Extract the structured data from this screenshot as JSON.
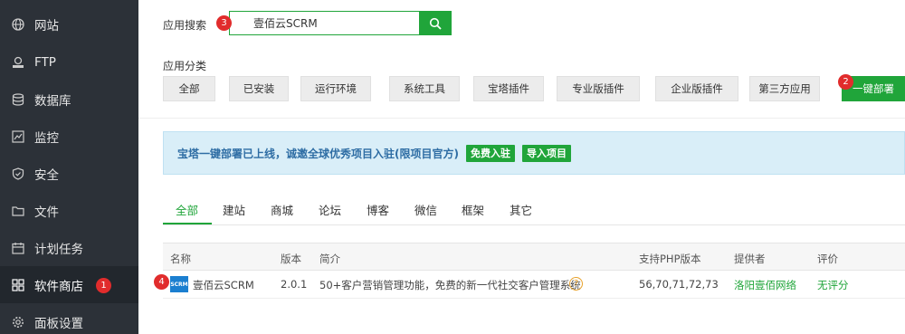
{
  "sidebar": {
    "items": [
      {
        "label": "网站",
        "icon": "globe-icon"
      },
      {
        "label": "FTP",
        "icon": "ftp-icon"
      },
      {
        "label": "数据库",
        "icon": "database-icon"
      },
      {
        "label": "监控",
        "icon": "monitor-icon"
      },
      {
        "label": "安全",
        "icon": "shield-icon"
      },
      {
        "label": "文件",
        "icon": "folder-icon"
      },
      {
        "label": "计划任务",
        "icon": "calendar-icon"
      },
      {
        "label": "软件商店",
        "icon": "grid-icon"
      },
      {
        "label": "面板设置",
        "icon": "gear-icon"
      }
    ],
    "active_index": 7
  },
  "annotations": {
    "n1": "1",
    "n2": "2",
    "n3": "3",
    "n4": "4"
  },
  "search": {
    "label": "应用搜索",
    "value": "壹佰云SCRM"
  },
  "category": {
    "label": "应用分类",
    "items": [
      "全部",
      "已安装",
      "运行环境",
      "系统工具",
      "宝塔插件",
      "专业版插件",
      "企业版插件",
      "第三方应用",
      "一键部署"
    ],
    "active": "一键部署"
  },
  "banner": {
    "text": "宝塔一键部署已上线，诚邀全球优秀项目入驻(限项目官方)",
    "btn_join": "免费入驻",
    "btn_import": "导入项目"
  },
  "tabs": {
    "items": [
      "全部",
      "建站",
      "商城",
      "论坛",
      "博客",
      "微信",
      "框架",
      "其它"
    ],
    "active": "全部"
  },
  "table": {
    "headers": [
      "名称",
      "版本",
      "简介",
      "支持PHP版本",
      "提供者",
      "评价"
    ],
    "rows": [
      {
        "name": "壹佰云SCRM",
        "logo_text": "SCRM",
        "version": "2.0.1",
        "desc": "50+客户营销管理功能，免费的新一代社交客户管理系统",
        "php": "56,70,71,72,73",
        "provider": "洛阳壹佰网络",
        "rating": "无评分"
      }
    ]
  },
  "colors": {
    "accent": "#20a53a",
    "sidebar_bg": "#2c3138",
    "badge": "#e12c2c",
    "banner_bg": "#d9eef8"
  }
}
